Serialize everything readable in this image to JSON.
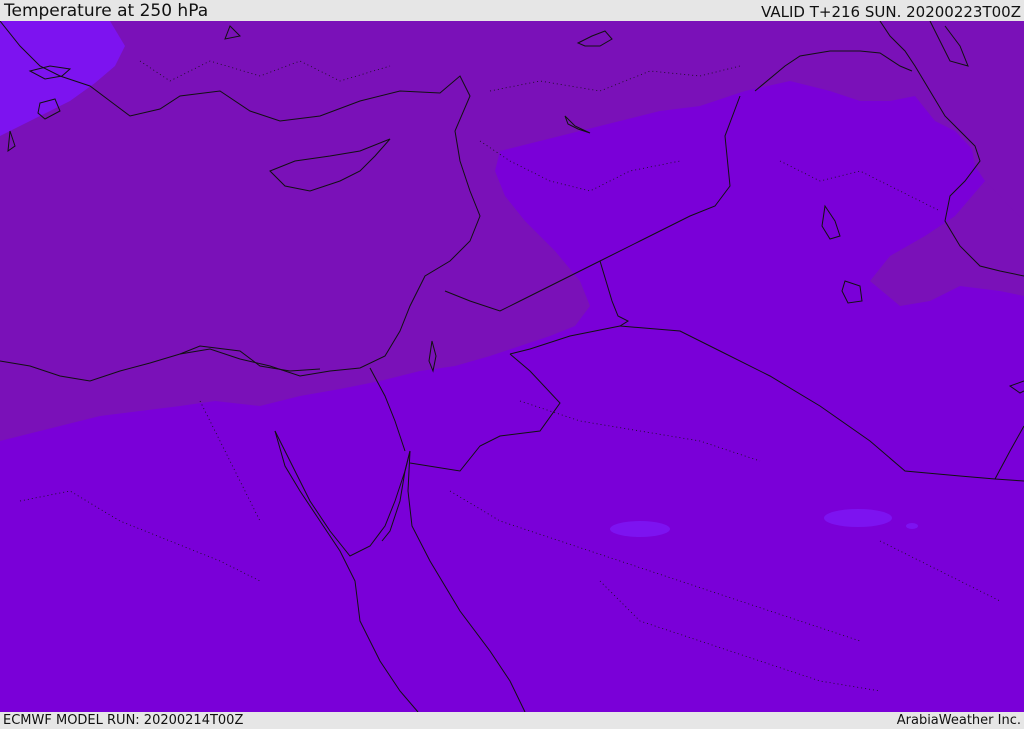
{
  "header": {
    "title": "Temperature at 250 hPa",
    "valid": "VALID T+216 SUN. 20200223T00Z"
  },
  "footer": {
    "model_run": "ECMWF MODEL RUN: 20200214T00Z",
    "credit": "ArabiaWeather Inc."
  },
  "map": {
    "colors": {
      "warm_band": "#7a11b8",
      "main_field": "#7a00d8",
      "cold_cells": "#7d13f0",
      "outline": "#111111"
    },
    "icons": [
      "coastline-icon",
      "border-icon"
    ]
  }
}
